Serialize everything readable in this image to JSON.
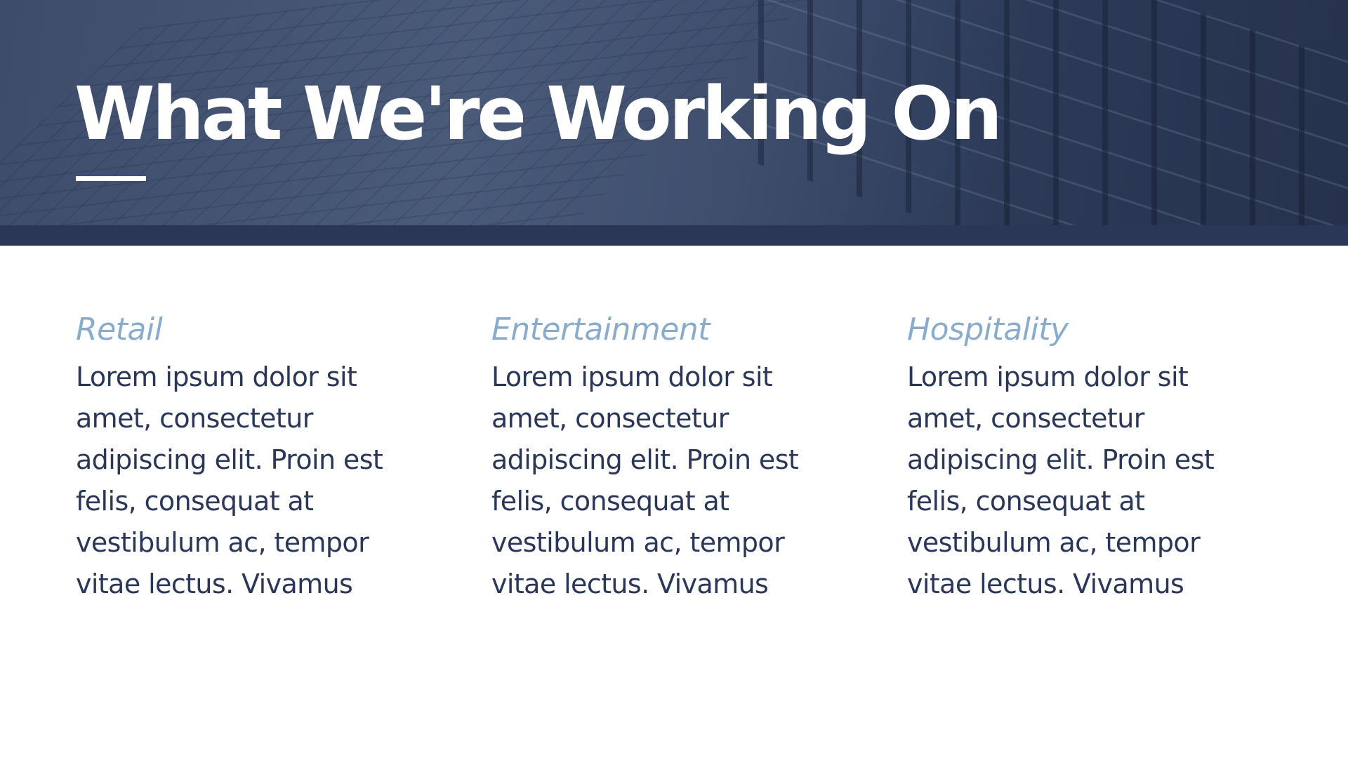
{
  "header": {
    "title": "What We're Working On"
  },
  "columns": [
    {
      "heading": "Retail",
      "body": "Lorem ipsum dolor sit amet, consectetur adipiscing elit. Proin est felis, consequat at vestibulum ac, tempor vitae lectus. Vivamus"
    },
    {
      "heading": "Entertainment",
      "body": "Lorem ipsum dolor sit amet, consectetur adipiscing elit. Proin est felis, consequat at vestibulum ac, tempor vitae lectus. Vivamus"
    },
    {
      "heading": "Hospitality",
      "body": "Lorem ipsum dolor sit amet, consectetur adipiscing elit. Proin est felis, consequat at vestibulum ac, tempor vitae lectus. Vivamus"
    }
  ],
  "colors": {
    "header_overlay": "#3f4e6d",
    "band": "#2a3756",
    "heading": "#8aaccc",
    "body_text": "#2b3756"
  }
}
